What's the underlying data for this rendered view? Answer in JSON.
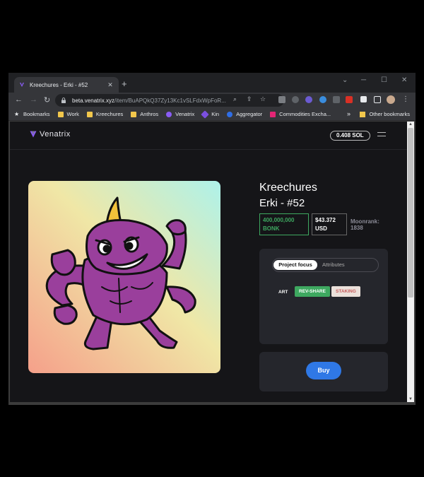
{
  "browser": {
    "tab_title": "Kreechures - Erki - #52",
    "tab_close": "✕",
    "new_tab": "+",
    "window_controls": {
      "menu": "⌄",
      "minimize": "─",
      "maximize": "☐",
      "close": "✕"
    },
    "nav": {
      "back": "←",
      "forward": "→",
      "reload": "↻"
    },
    "url_host": "beta.venatrix.xyz",
    "url_path": "/item/BuAPQkQ37Zy13Kc1vSLFdxWpFoR...",
    "omnibox_icons": {
      "search": "⌕",
      "share": "⇪",
      "bookmark": "☆"
    },
    "kebab_menu": "⋮",
    "bookmarks": [
      {
        "label": "Bookmarks",
        "icon": "star-bookmark-icon"
      },
      {
        "label": "Work",
        "icon": "folder-icon"
      },
      {
        "label": "Kreechures",
        "icon": "folder-icon"
      },
      {
        "label": "Anthros",
        "icon": "folder-icon"
      },
      {
        "label": "Venatrix",
        "icon": "venatrix-icon"
      },
      {
        "label": "Kin",
        "icon": "kin-icon"
      },
      {
        "label": "Aggregator",
        "icon": "aggregator-icon"
      },
      {
        "label": "Commodities Excha...",
        "icon": "me-icon"
      }
    ],
    "bookmarks_more": "»",
    "other_bookmarks": "Other bookmarks"
  },
  "site": {
    "logo_text": "Venatrix",
    "balance": "0.408 SOL",
    "collection": "Kreechures",
    "item_name": "Erki - #52",
    "price_bonk_amount": "400,000,000",
    "price_bonk_unit": "BONK",
    "price_usd_amount": "$43.372",
    "price_usd_unit": "USD",
    "moonrank_label": "Moonrank:",
    "moonrank_value": "1838",
    "tabs": {
      "active": "Project focus",
      "inactive": "Attributes"
    },
    "tag_art": "ART",
    "badge_rev": "REV-SHARE",
    "badge_staking": "STAKING",
    "buy_label": "Buy"
  },
  "colors": {
    "accent_green": "#3ea860",
    "buy_blue": "#2f78e6",
    "page_bg": "#151518",
    "panel_bg": "#25262c",
    "creature_purple": "#9a3f9c"
  }
}
